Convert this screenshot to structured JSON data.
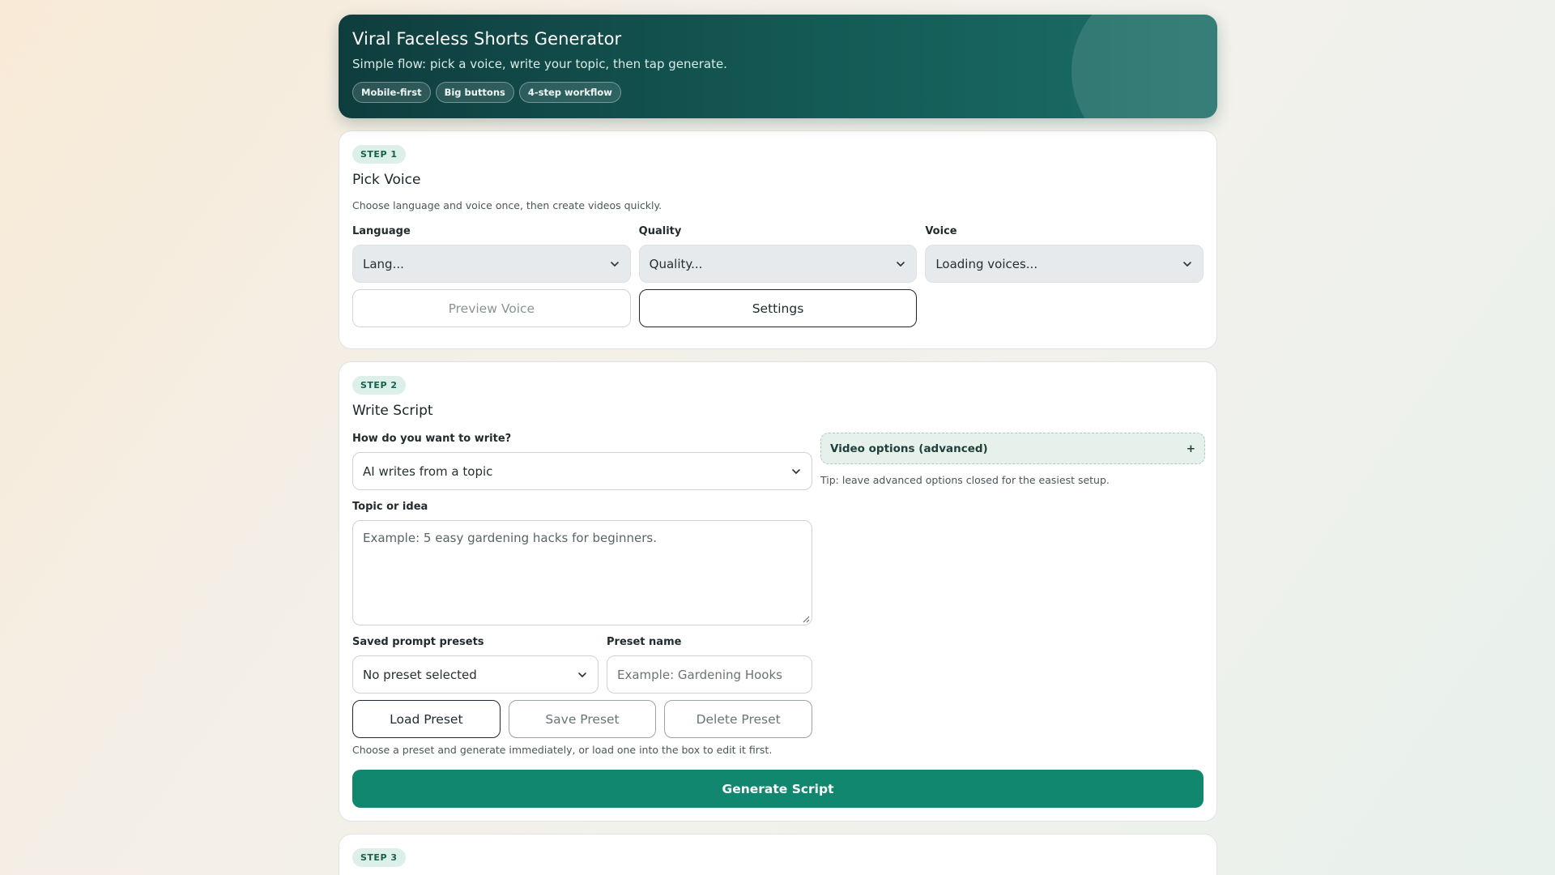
{
  "header": {
    "title": "Viral Faceless Shorts Generator",
    "subtitle": "Simple flow: pick a voice, write your topic, then tap generate.",
    "chips": [
      "Mobile-first",
      "Big buttons",
      "4-step workflow"
    ]
  },
  "step1": {
    "badge": "STEP 1",
    "title": "Pick Voice",
    "description": "Choose language and voice once, then create videos quickly.",
    "language_label": "Language",
    "language_value": "Lang...",
    "quality_label": "Quality",
    "quality_value": "Quality...",
    "voice_label": "Voice",
    "voice_value": "Loading voices...",
    "preview_button": "Preview Voice",
    "settings_button": "Settings"
  },
  "step2": {
    "badge": "STEP 2",
    "title": "Write Script",
    "mode_label": "How do you want to write?",
    "mode_value": "AI writes from a topic",
    "topic_label": "Topic or idea",
    "topic_placeholder": "Example: 5 easy gardening hacks for beginners.",
    "advanced_label": "Video options (advanced)",
    "advanced_toggle": "+",
    "tip": "Tip: leave advanced options closed for the easiest setup.",
    "presets_label": "Saved prompt presets",
    "presets_value": "No preset selected",
    "preset_name_label": "Preset name",
    "preset_name_placeholder": "Example: Gardening Hooks",
    "load_button": "Load Preset",
    "save_button": "Save Preset",
    "delete_button": "Delete Preset",
    "help_text": "Choose a preset and generate immediately, or load one into the box to edit it first.",
    "generate_button": "Generate Script"
  },
  "step3": {
    "badge": "STEP 3"
  },
  "colors": {
    "hero_dark": "#0f3d3e",
    "primary": "#11876f",
    "badge_bg": "#dcefe8"
  }
}
